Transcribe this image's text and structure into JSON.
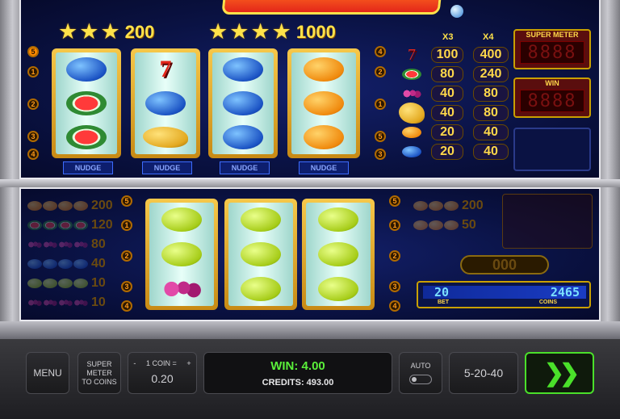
{
  "title_prefix": "",
  "paylines_top": {
    "left": [
      "5",
      "1",
      "2",
      "3",
      "4"
    ],
    "right": [
      "4",
      "2",
      "1",
      "5",
      "3"
    ]
  },
  "star_wins": [
    {
      "stars": 3,
      "value": "200"
    },
    {
      "stars": 4,
      "value": "1000"
    }
  ],
  "reels_top": [
    [
      "plum",
      "melon",
      "melon"
    ],
    [
      "seven",
      "plum",
      "pear"
    ],
    [
      "plum",
      "plum",
      "plum"
    ],
    [
      "orange",
      "orange",
      "orange"
    ]
  ],
  "nudge_label": "NUDGE",
  "paytable": {
    "header_x3": "X3",
    "header_x4": "X4",
    "rows": [
      {
        "symbol": "seven",
        "x3": "100",
        "x4": "400"
      },
      {
        "symbol": "melon",
        "x3": "80",
        "x4": "240"
      },
      {
        "symbol": "grapes",
        "x3": "40",
        "x4": "80"
      },
      {
        "symbol": "pear",
        "x3": "40",
        "x4": "80"
      },
      {
        "symbol": "orange",
        "x3": "20",
        "x4": "40"
      },
      {
        "symbol": "plum",
        "x3": "20",
        "x4": "40"
      }
    ]
  },
  "super_meter": {
    "label": "SUPER METER",
    "digits": "8888"
  },
  "win_meter": {
    "label": "WIN",
    "digits": "8888"
  },
  "reels_bottom": [
    [
      "lemon",
      "lemon",
      "grapes"
    ],
    [
      "lemon",
      "lemon",
      "lemon"
    ],
    [
      "lemon",
      "lemon",
      "lemon"
    ]
  ],
  "lower_paytable": [
    {
      "symbol": "orange",
      "value": "200"
    },
    {
      "symbol": "melon",
      "value": "120"
    },
    {
      "symbol": "grapes",
      "value": "80"
    },
    {
      "symbol": "plum",
      "value": "40"
    },
    {
      "symbol": "lemon",
      "value": "10"
    },
    {
      "symbol": "grapes",
      "value": "10"
    }
  ],
  "lower_right_pay": [
    {
      "value": "200"
    },
    {
      "value": "50"
    }
  ],
  "coin_display": "000",
  "counter": {
    "bet": "20",
    "coins": "2465",
    "bet_label": "BET",
    "coins_label": "COINS"
  },
  "controls": {
    "menu": "MENU",
    "super_meter_to_coins": "SUPER METER TO COINS",
    "coin_minus": "-",
    "coin_label": "1 COIN =",
    "coin_plus": "+",
    "coin_value": "0.20",
    "win": "WIN: 4.00",
    "credits": "CREDITS: 493.00",
    "auto": "AUTO",
    "lines": "5-20-40",
    "spin_icon": "double-chevron-right-icon"
  },
  "colors": {
    "accent_green": "#4ae02a",
    "win_text": "#5af03a",
    "gold": "#ffd84a"
  }
}
